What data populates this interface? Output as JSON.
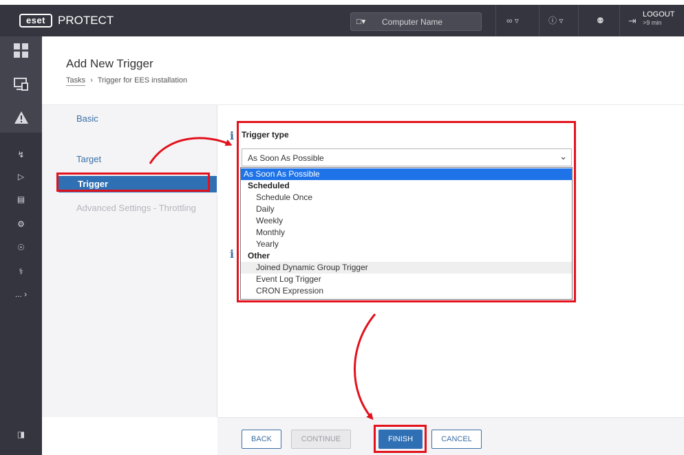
{
  "topbar": {
    "logo": "eset",
    "product": "PROTECT",
    "search_placeholder": "Computer Name",
    "logout_label": "LOGOUT",
    "logout_timer": ">9 min",
    "icons": [
      "computer-dropdown-icon",
      "link-icon",
      "help-icon",
      "user-icon",
      "logout-icon"
    ]
  },
  "leftnav": {
    "icons": [
      "dashboard-icon",
      "computers-icon",
      "alert-icon",
      "reports-icon",
      "tasks-icon",
      "installers-icon",
      "policies-icon",
      "notifications-icon",
      "status-icon",
      "more-icon",
      "collapse-icon"
    ],
    "more_label": "..."
  },
  "header": {
    "title": "Add New Trigger",
    "breadcrumb_root": "Tasks",
    "breadcrumb_current": "Trigger for EES installation"
  },
  "steps": {
    "items": [
      {
        "label": "Basic",
        "state": "link"
      },
      {
        "label": "Target",
        "state": "link"
      },
      {
        "label": "Trigger",
        "state": "active"
      },
      {
        "label": "Advanced Settings - Throttling",
        "state": "disabled"
      }
    ]
  },
  "trigger": {
    "field_label": "Trigger type",
    "selected_value": "As Soon As Possible",
    "options": [
      {
        "label": "As Soon As Possible",
        "kind": "option",
        "selected": true
      },
      {
        "label": "Scheduled",
        "kind": "group"
      },
      {
        "label": "Schedule Once",
        "kind": "option"
      },
      {
        "label": "Daily",
        "kind": "option"
      },
      {
        "label": "Weekly",
        "kind": "option"
      },
      {
        "label": "Monthly",
        "kind": "option"
      },
      {
        "label": "Yearly",
        "kind": "option"
      },
      {
        "label": "Other",
        "kind": "group"
      },
      {
        "label": "Joined Dynamic Group Trigger",
        "kind": "option",
        "hovered": true
      },
      {
        "label": "Event Log Trigger",
        "kind": "option"
      },
      {
        "label": "CRON Expression",
        "kind": "option"
      }
    ]
  },
  "footer": {
    "back_label": "BACK",
    "continue_label": "CONTINUE",
    "finish_label": "FINISH",
    "cancel_label": "CANCEL"
  },
  "colors": {
    "topbar": "#35353f",
    "accent_blue": "#2f6fb4",
    "select_highlight": "#1e73e8",
    "annotation_red": "#e3111b"
  }
}
